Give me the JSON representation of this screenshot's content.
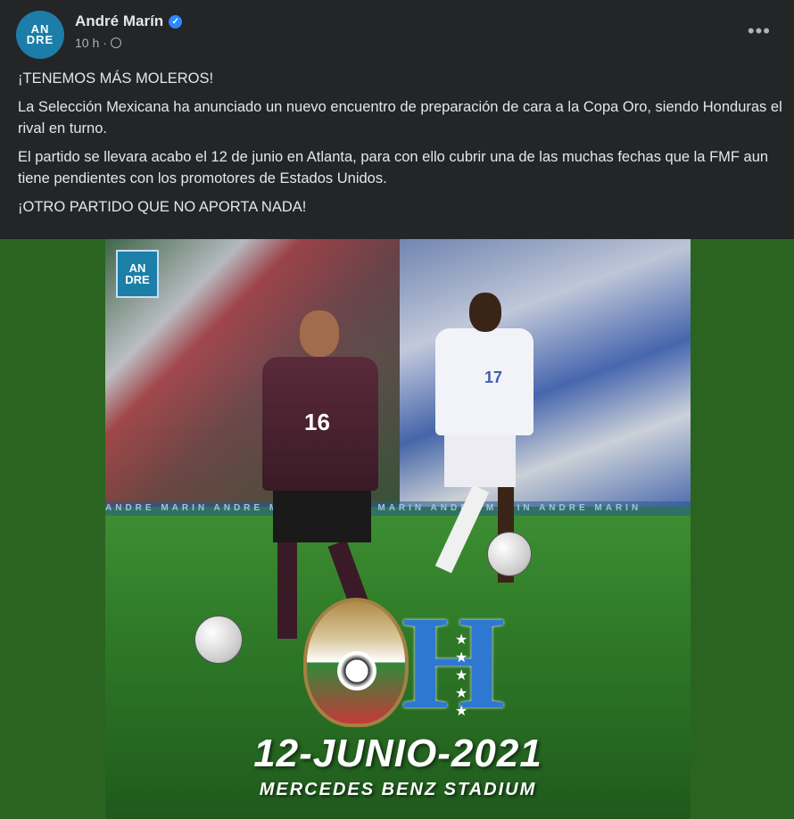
{
  "post": {
    "author": "André Marín",
    "time": "10 h",
    "avatar_text": [
      "AN",
      "DRE"
    ],
    "paragraphs": [
      "¡TENEMOS MÁS MOLEROS!",
      "La Selección Mexicana ha anunciado un nuevo encuentro de preparación de cara a la Copa Oro, siendo Honduras el rival en turno.",
      "El partido se llevara acabo el 12 de junio en Atlanta, para con ello cubrir una de las muchas fechas que la FMF aun tiene pendientes con los promotores de Estados Unidos.",
      "¡OTRO PARTIDO QUE NO APORTA NADA!"
    ]
  },
  "image": {
    "logo_text": [
      "AN",
      "DRE"
    ],
    "watermark": "ANDRE MARIN    ANDRE MARIN    ANDRE MARIN    ANDRE MARIN    ANDRE MARIN",
    "player_mexico_number": "16",
    "player_honduras_number": "17",
    "letter": "H",
    "date": "12-JUNIO-2021",
    "venue": "MERCEDES BENZ STADIUM"
  },
  "colors": {
    "background": "#242526",
    "text": "#e4e6eb",
    "muted": "#b0b3b8",
    "verified": "#2d88ff",
    "media_bg": "#2b6420"
  },
  "icons": {
    "verified": "verified-badge-icon",
    "privacy": "globe-icon",
    "menu": "more-options-icon"
  }
}
